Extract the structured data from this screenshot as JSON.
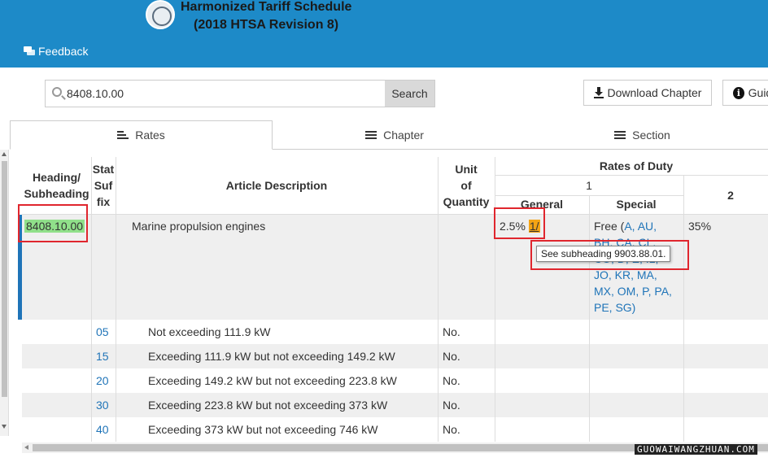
{
  "app": {
    "title_line1": "Harmonized Tariff Schedule",
    "title_line2": "(2018 HTSA Revision 8)",
    "feedback_label": "Feedback",
    "seal_icon": "government-seal-icon"
  },
  "search": {
    "value": "8408.10.00",
    "placeholder": "",
    "button_label": "Search"
  },
  "toolbar": {
    "download_label": "Download Chapter",
    "guide_label": "Guide"
  },
  "tabs": [
    {
      "label": "Rates",
      "active": true
    },
    {
      "label": "Chapter",
      "active": false
    },
    {
      "label": "Section",
      "active": false
    }
  ],
  "table": {
    "headers": {
      "heading": [
        "Heading/",
        "Subheading"
      ],
      "stat_suffix": [
        "Stat",
        "Suf",
        "fix"
      ],
      "description": "Article Description",
      "unit": [
        "Unit",
        "of",
        "Quantity"
      ],
      "rates_of_duty": "Rates of Duty",
      "col1": "1",
      "general": "General",
      "special": "Special",
      "col2": "2"
    },
    "main_row": {
      "heading": "8408.10.00",
      "description": "Marine propulsion engines",
      "general_rate": "2.5%",
      "footnote": "1/",
      "special_prefix": "Free (",
      "special_lines": [
        "A, AU,",
        "BH, CA, CL,",
        "CO, D, E, IL,",
        "JO, KR, MA,",
        "MX, OM, P, PA,",
        "PE, SG)"
      ],
      "col2_rate": "35%"
    },
    "sub_rows": [
      {
        "suffix": "05",
        "description": "Not exceeding 111.9 kW",
        "unit": "No."
      },
      {
        "suffix": "15",
        "description": "Exceeding 111.9 kW but not exceeding 149.2 kW",
        "unit": "No."
      },
      {
        "suffix": "20",
        "description": "Exceeding 149.2 kW but not exceeding 223.8 kW",
        "unit": "No."
      },
      {
        "suffix": "30",
        "description": "Exceeding 223.8 kW but not exceeding 373 kW",
        "unit": "No."
      },
      {
        "suffix": "40",
        "description": "Exceeding 373 kW but not exceeding 746 kW",
        "unit": "No."
      }
    ]
  },
  "tooltip": {
    "text": "See subheading 9903.88.01."
  },
  "watermark": "GUOWAIWANGZHUAN.COM",
  "colors": {
    "header_bg": "#1d8ac8",
    "link": "#1f74b8",
    "highlight": "#90e08a",
    "footnote": "#f4a415",
    "annotation_red": "#e0262e"
  }
}
